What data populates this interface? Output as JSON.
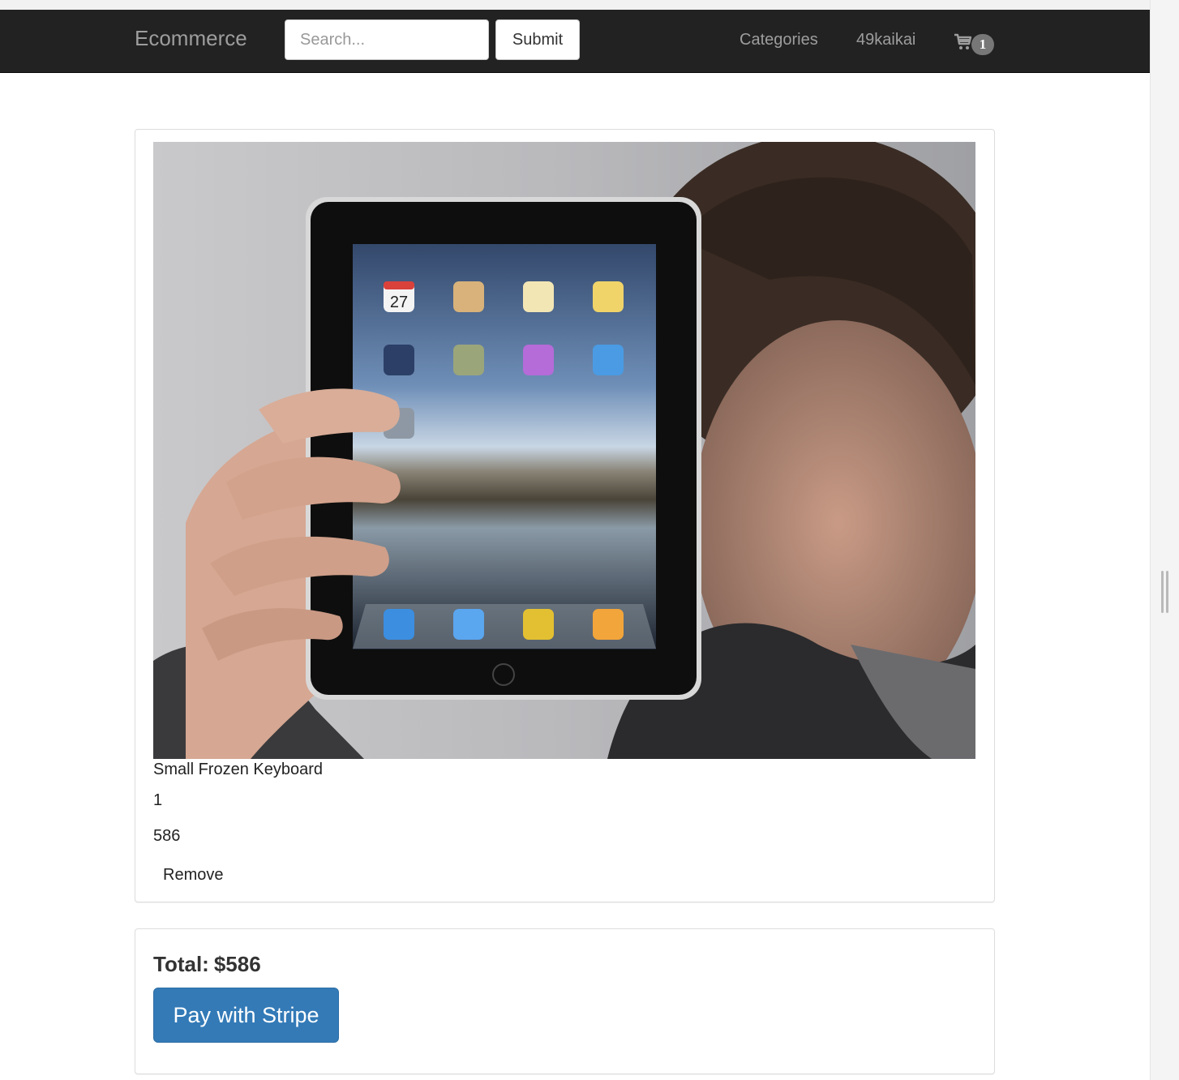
{
  "navbar": {
    "brand": "Ecommerce",
    "search": {
      "placeholder": "Search...",
      "value": ""
    },
    "submit_label": "Submit",
    "categories_label": "Categories",
    "user_label": "49kaikai",
    "cart_count": "1"
  },
  "cart_item": {
    "image_icon": "tablet-product-photo",
    "name": "Small Frozen Keyboard",
    "quantity": "1",
    "price": "586",
    "remove_label": "Remove"
  },
  "summary": {
    "total_label": "Total:",
    "total_value": "$586",
    "pay_label": "Pay with Stripe"
  },
  "colors": {
    "navbar_bg": "#222222",
    "nav_text": "#9d9d9d",
    "primary_button": "#337ab7",
    "badge": "#777777"
  }
}
